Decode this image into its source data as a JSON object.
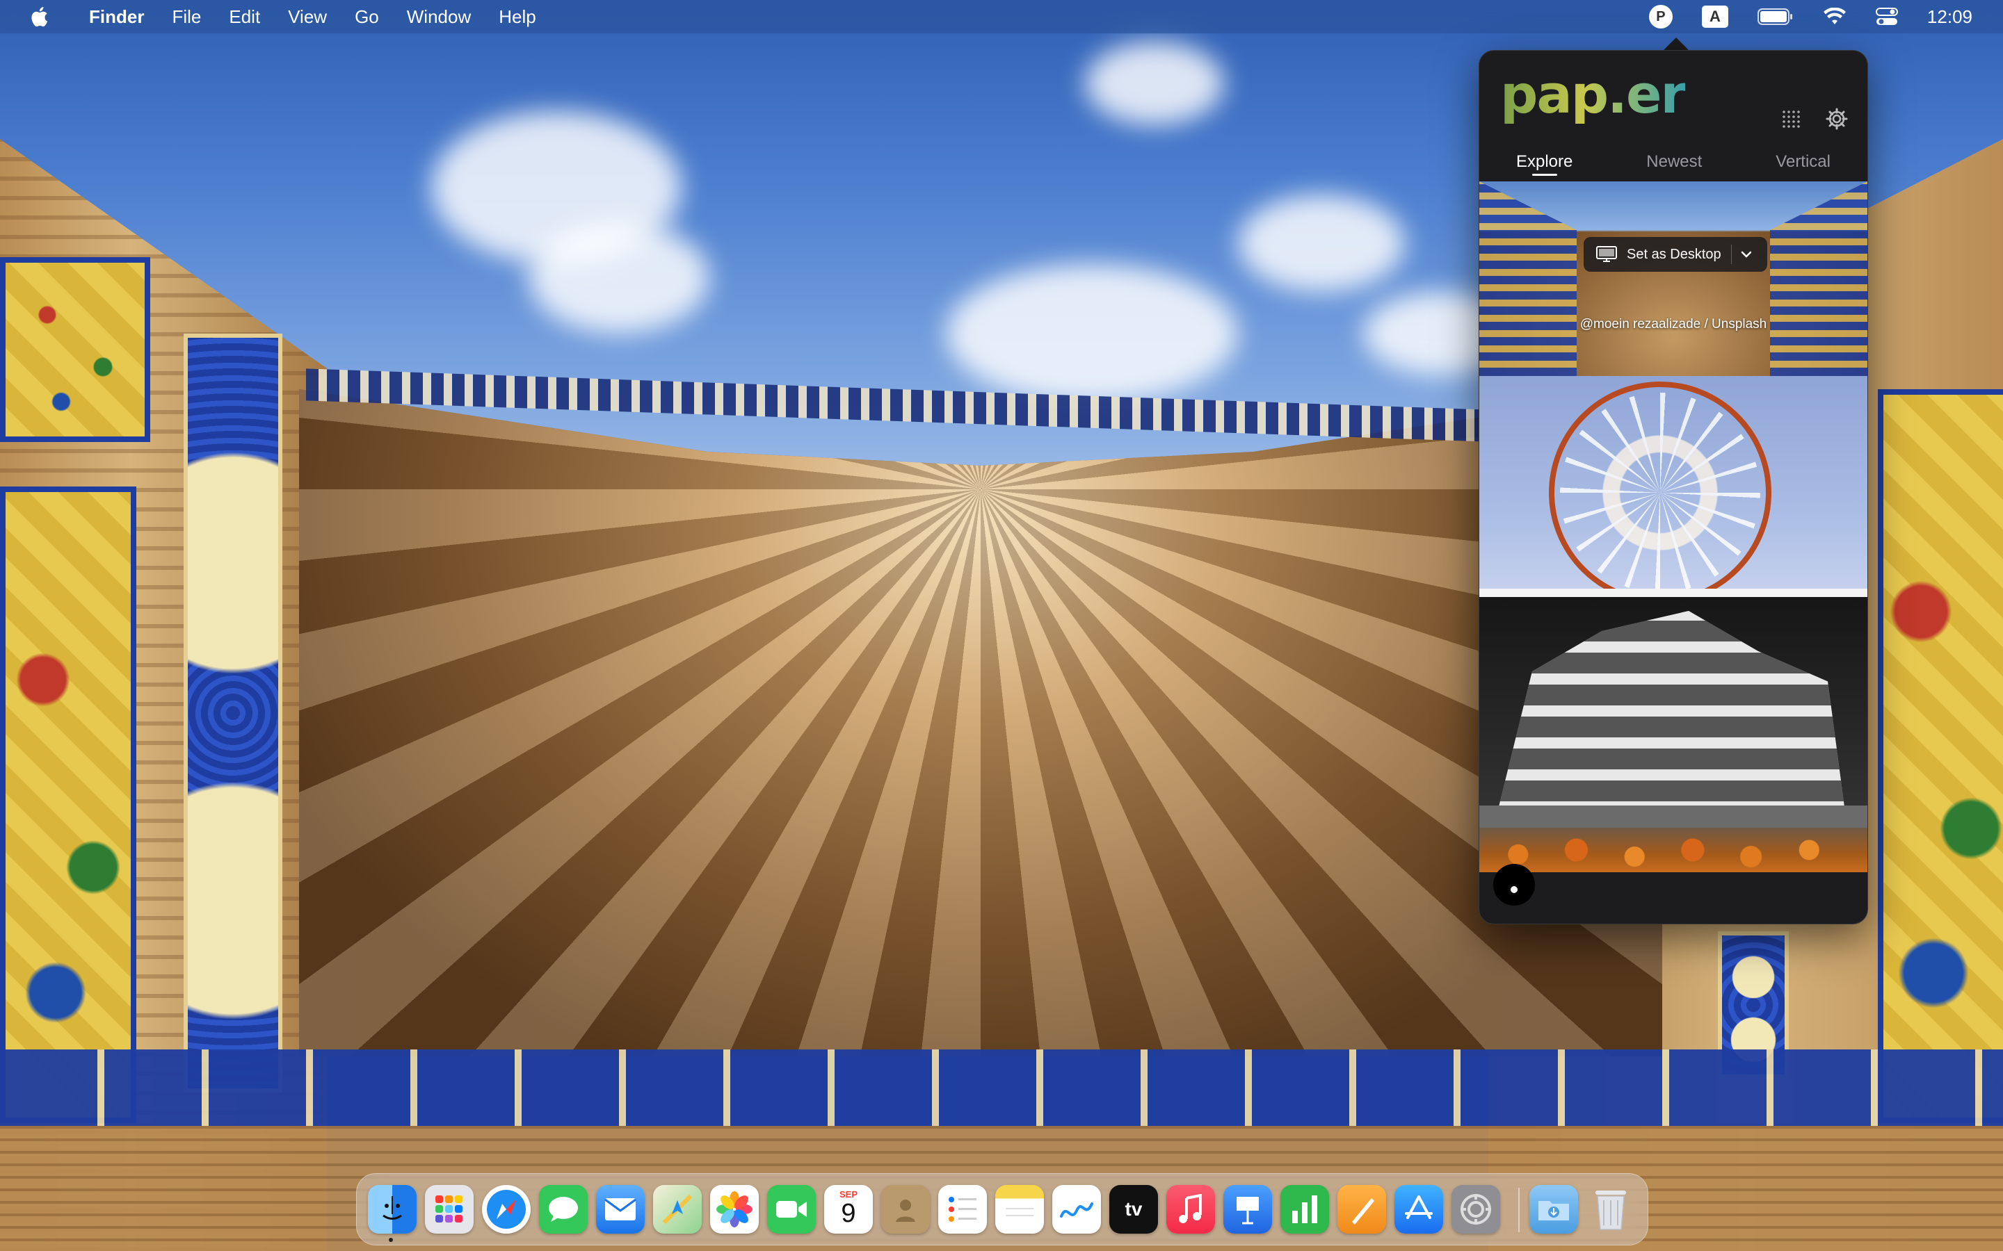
{
  "menubar": {
    "apple_icon": "apple-icon",
    "app_name": "Finder",
    "menus": [
      "File",
      "Edit",
      "View",
      "Go",
      "Window",
      "Help"
    ],
    "status": {
      "paper_icon_letter": "P",
      "input_source_letter": "A",
      "battery_icon": "battery-icon",
      "wifi_icon": "wifi-icon",
      "control_center_icon": "control-center-icon",
      "clock": "12:09"
    }
  },
  "paper_app": {
    "logo": "pap.er",
    "header_icons": [
      "grid-dots-icon",
      "gear-icon"
    ],
    "tabs": [
      {
        "label": "Explore",
        "active": true
      },
      {
        "label": "Newest",
        "active": false
      },
      {
        "label": "Vertical",
        "active": false
      }
    ],
    "set_desktop_label": "Set as Desktop",
    "credit": "@moein rezaalizade / Unsplash",
    "thumbnails": [
      "mosque-muqarnas-thumbnail",
      "basketball-hoop-thumbnail",
      "modern-building-thumbnail",
      "pumpkins-thumbnail"
    ]
  },
  "dock": {
    "apps": [
      {
        "name": "Finder",
        "color": "#2f8ef0"
      },
      {
        "name": "Launchpad",
        "color": "#e5e5ea"
      },
      {
        "name": "Safari",
        "color": "#1e8ef5"
      },
      {
        "name": "Messages",
        "color": "#34c759"
      },
      {
        "name": "Mail",
        "color": "#3d8ff5"
      },
      {
        "name": "Maps",
        "color": "#5fbf64"
      },
      {
        "name": "Photos",
        "color": "#ffffff"
      },
      {
        "name": "FaceTime",
        "color": "#34c759"
      },
      {
        "name": "Calendar",
        "color": "#ffffff"
      },
      {
        "name": "Contacts",
        "color": "#b89a6d"
      },
      {
        "name": "Reminders",
        "color": "#ffffff"
      },
      {
        "name": "Notes",
        "color": "#f7d54a"
      },
      {
        "name": "Freeform",
        "color": "#ffffff"
      },
      {
        "name": "TV",
        "color": "#111111"
      },
      {
        "name": "Music",
        "color": "#fa3a55"
      },
      {
        "name": "Keynote",
        "color": "#2f7cf6"
      },
      {
        "name": "Numbers",
        "color": "#2fb84c"
      },
      {
        "name": "Pages",
        "color": "#f59a2a"
      },
      {
        "name": "App Store",
        "color": "#1f8ef5"
      },
      {
        "name": "System Settings",
        "color": "#8e8e93"
      },
      {
        "name": "Downloads",
        "color": "#5aa8e8"
      },
      {
        "name": "Trash",
        "color": "#d8dde2"
      }
    ],
    "calendar": {
      "month": "SEP",
      "day": "9"
    },
    "tv_label": "tv"
  }
}
